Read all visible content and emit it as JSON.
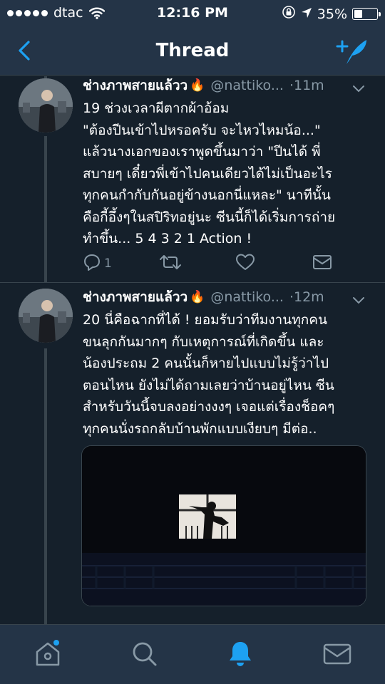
{
  "status_bar": {
    "carrier": "dtac",
    "time": "12:16 PM",
    "battery": "35%",
    "battery_level": 0.35
  },
  "nav": {
    "title": "Thread",
    "back_icon": "chevron-left-icon",
    "compose_icon": "compose-tweet-icon"
  },
  "tweets": [
    {
      "name": "ช่างภาพสายแล้วว",
      "emoji": "🔥",
      "handle": "@nattiko...",
      "time": "·11m",
      "lines": [
        "19 ช่วงเวลาผีตากผ้าอ้อม",
        "\"ต้องปีนเข้าไปหรอครับ จะไหวไหมน้อ...\"",
        "แล้วนางเอกของเราพูดขึ้นมาว่า \"ปีนได้  พี่",
        "สบายๆ เดี๋ยวพี่เข้าไปคนเดียวได้ไม่เป็นอะไร",
        "ทุกคนกำกับกันอยู่ข้างนอกนี่แหละ\" นาทีนั้น",
        "คือกี้อึ้งๆในสปิริทอยู่นะ ซีนนี้ก็ได้เริ่มการถ่าย",
        "ทำขึ้น... 5 4 3 2 1 Action !"
      ],
      "reply_count": "1"
    },
    {
      "name": "ช่างภาพสายแล้วว",
      "emoji": "🔥",
      "handle": "@nattiko...",
      "time": "·12m",
      "lines": [
        "20 นี่คือฉากที่ได้ ! ยอมรับว่าทีมงานทุกคน",
        "ขนลุกกันมากๆ กับเหตุการณ์ที่เกิดขึ้น และ",
        "น้องประถม 2 คนนั้นก็หายไปแบบไม่รู้ว่าไป",
        "ตอนไหน ยังไม่ได้ถามเลยว่าบ้านอยู่ไหน ซีน",
        "สำหรับวันนี้จบลงอย่างงงๆ เจอแต่เรื่องช็อคๆ",
        "ทุกคนนั่งรถกลับบ้านพักแบบเงียบๆ มีต่อ.."
      ]
    }
  ],
  "tabs": [
    "home-icon",
    "search-icon",
    "notifications-icon",
    "messages-icon"
  ],
  "colors": {
    "background": "#15202b",
    "bar": "#243447",
    "accent": "#1da1f2",
    "secondary_text": "#8899a6"
  }
}
